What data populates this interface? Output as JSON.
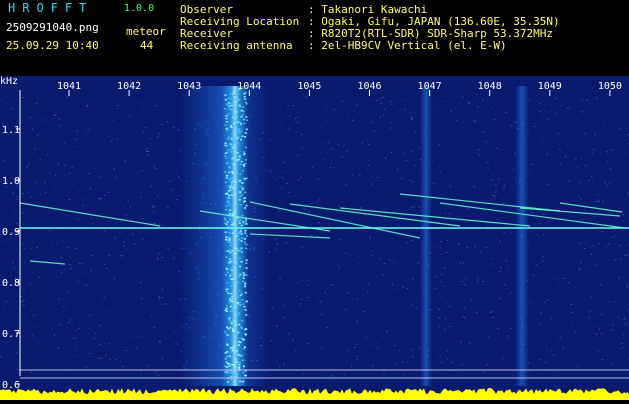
{
  "header": {
    "app_title": "HROFFT",
    "app_version": "1.0.0",
    "file_name": "2509291040.png",
    "date_time": "25.09.29 10:40",
    "meteor_label": "meteor",
    "meteor_count": "44"
  },
  "info": [
    {
      "label": "Observer",
      "value": ": Takanori Kawachi"
    },
    {
      "label": "Receiving Location",
      "value": ": Ogaki, Gifu, JAPAN (136.60E, 35.35N)"
    },
    {
      "label": "Receiver",
      "value": ": R820T2(RTL-SDR) SDR-Sharp 53.372MHz"
    },
    {
      "label": "Receiving antenna",
      "value": ": 2el-HB9CV Vertical (el. E-W)"
    }
  ],
  "spectrogram": {
    "x_unit": "kHz",
    "x_ticks": [
      "1041",
      "1042",
      "1043",
      "1044",
      "1045",
      "1046",
      "1047",
      "1048",
      "1049",
      "1050"
    ],
    "y_ticks": [
      "1.1",
      "1.0",
      "0.9",
      "0.8",
      "0.7",
      "0.6"
    ],
    "colors": {
      "background": "#0a1a6e",
      "signal": "#33ccff",
      "amplitude": "#ffff00",
      "axis_text": "#ffffff",
      "header_cyan": "#22ddee",
      "header_green": "#44ff44"
    }
  }
}
